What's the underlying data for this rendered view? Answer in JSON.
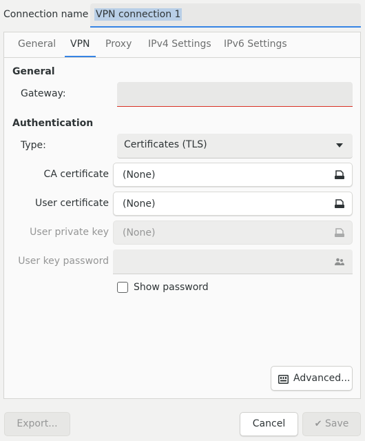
{
  "connection": {
    "label": "Connection name",
    "value": "VPN connection 1"
  },
  "tabs": [
    {
      "label": "General"
    },
    {
      "label": "VPN",
      "active": true
    },
    {
      "label": "Proxy"
    },
    {
      "label": "IPv4 Settings"
    },
    {
      "label": "IPv6 Settings"
    }
  ],
  "general": {
    "heading": "General",
    "gateway_label": "Gateway:",
    "gateway_value": ""
  },
  "auth": {
    "heading": "Authentication",
    "type_label": "Type:",
    "type_value": "Certificates (TLS)",
    "ca_label": "CA certificate",
    "ca_value": "(None)",
    "user_cert_label": "User certificate",
    "user_cert_value": "(None)",
    "private_key_label": "User private key",
    "private_key_value": "(None)",
    "key_password_label": "User key password",
    "show_password_label": "Show password",
    "show_password_checked": false
  },
  "advanced_label": "Advanced...",
  "footer": {
    "export_label": "Export...",
    "cancel_label": "Cancel",
    "save_label": "Save"
  },
  "colors": {
    "accent": "#3584e4",
    "error": "#d93025",
    "selection": "#b9cfe7"
  },
  "icons": {
    "file": "document-open-icon",
    "people": "users-icon",
    "advanced": "settings-panel-icon",
    "save": "checkmark-icon"
  }
}
